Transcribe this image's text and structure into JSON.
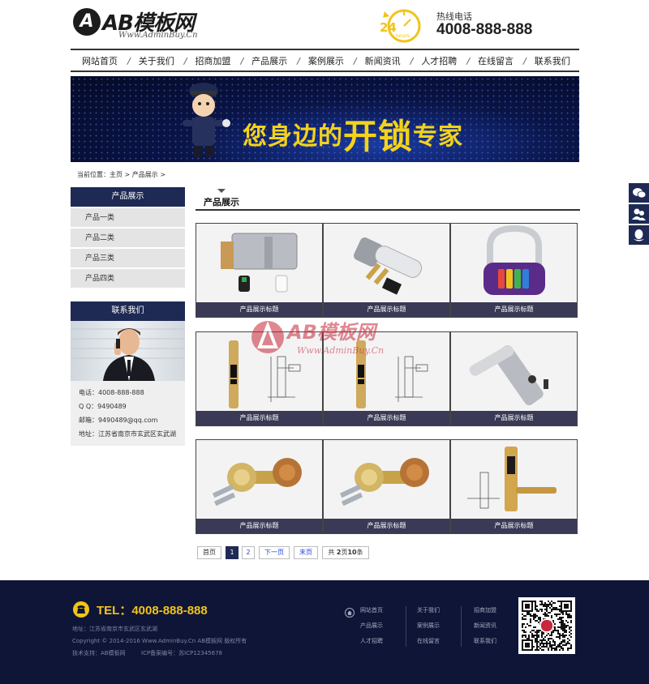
{
  "header": {
    "logo_text": "AB模板网",
    "logo_letter": "A",
    "logo_url": "Www.AdminBuy.Cn",
    "hotline_label": "热线电话",
    "hotline_number": "4008-888-888",
    "hotline_badge": "24",
    "hotline_badge_sub": "hours"
  },
  "nav": {
    "items": [
      "网站首页",
      "关于我们",
      "招商加盟",
      "产品展示",
      "案例展示",
      "新闻资讯",
      "人才招聘",
      "在线留言",
      "联系我们"
    ],
    "separator": "/"
  },
  "banner": {
    "text_a": "您身边的",
    "text_b": "开锁",
    "text_c": "专家"
  },
  "breadcrumb": {
    "text": "当前位置：主页 > 产品展示 >"
  },
  "sidebar": {
    "category_title": "产品展示",
    "categories": [
      "产品一类",
      "产品二类",
      "产品三类",
      "产品四类"
    ],
    "contact_title": "联系我们",
    "contact": {
      "phone": "电话：4008-888-888",
      "qq": "Q Q：9490489",
      "email": "邮箱：9490489@qq.com",
      "address": "地址：江苏省南京市玄武区玄武湖"
    }
  },
  "main": {
    "title": "产品展示",
    "products": [
      {
        "caption": "产品展示标题",
        "image": "mortise-lock-icon"
      },
      {
        "caption": "产品展示标题",
        "image": "cylinder-lock-icon"
      },
      {
        "caption": "产品展示标题",
        "image": "combination-padlock-icon"
      },
      {
        "caption": "产品展示标题",
        "image": "digital-door-lock-icon"
      },
      {
        "caption": "产品展示标题",
        "image": "digital-door-lock-icon"
      },
      {
        "caption": "产品展示标题",
        "image": "lever-handle-lock-icon"
      },
      {
        "caption": "产品展示标题",
        "image": "knob-lock-icon"
      },
      {
        "caption": "产品展示标题",
        "image": "knob-lock-icon"
      },
      {
        "caption": "产品展示标题",
        "image": "smart-lock-icon"
      }
    ],
    "watermark": {
      "text": "AB模板网",
      "url": "Www.AdminBuy.Cn"
    }
  },
  "pagination": {
    "first": "首页",
    "pages": [
      "1",
      "2"
    ],
    "current": "1",
    "next": "下一页",
    "last": "末页",
    "summary_a": "共 ",
    "summary_pages": "2",
    "summary_b": "页",
    "summary_count": "10",
    "summary_c": "条"
  },
  "footer": {
    "phone": "TEL：4008-888-888",
    "address": "地址：江苏省南京市玄武区玄武湖",
    "copyright": "Copyright © 2014-2016 Www.AdminBuy.Cn AB模板网 版权所有",
    "support": "技术支持：AB模板网",
    "icp": "ICP备案编号：苏ICP12345678",
    "links_col1": [
      "网站首页",
      "产品展示",
      "人才招聘"
    ],
    "links_col2": [
      "关于我们",
      "案例展示",
      "在线留言"
    ],
    "links_col3": [
      "招商加盟",
      "新闻资讯",
      "联系我们"
    ]
  },
  "colors": {
    "accent_navy": "#1e2a54",
    "footer_bg": "#0f1536",
    "yellow": "#f0c419"
  }
}
